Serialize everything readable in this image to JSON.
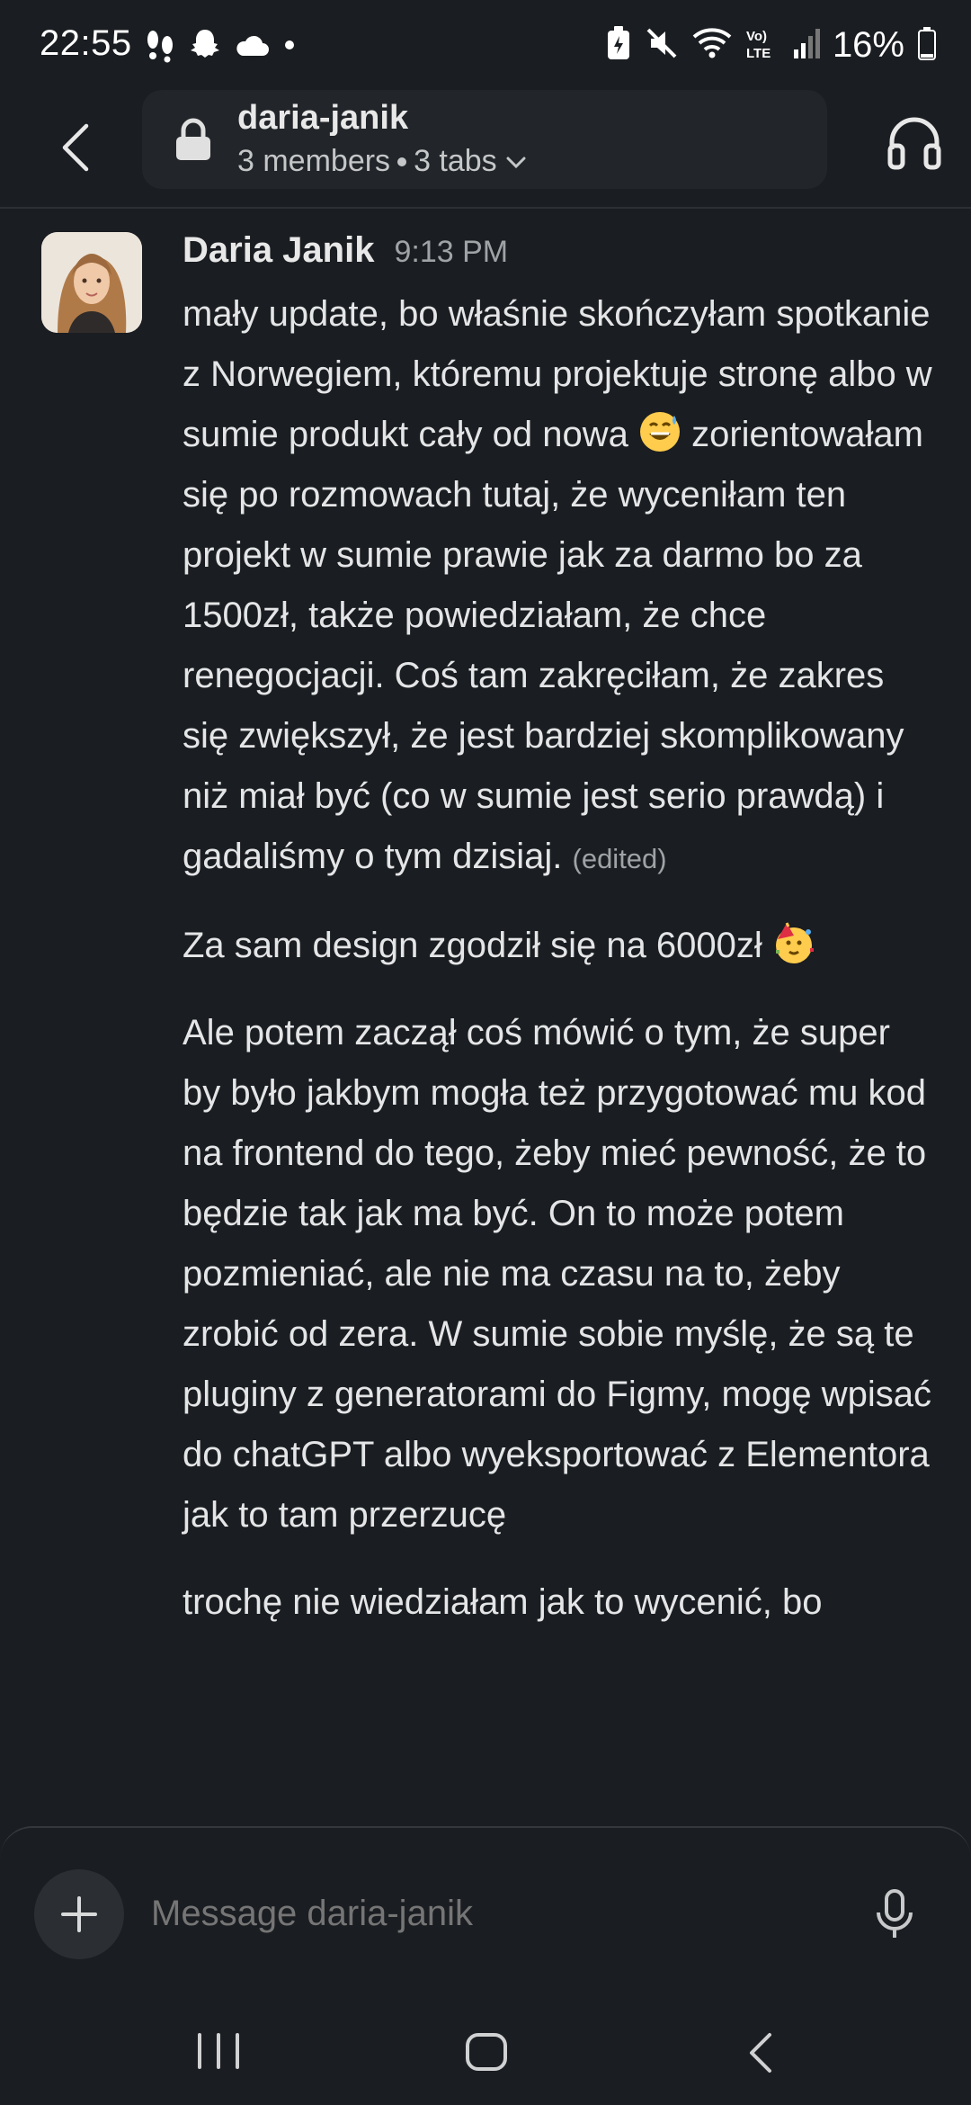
{
  "status_bar": {
    "time": "22:55",
    "battery": "16%"
  },
  "header": {
    "channel_name": "daria-janik",
    "members": "3 members",
    "tabs": "3 tabs"
  },
  "message": {
    "author": "Daria Janik",
    "time": "9:13 PM",
    "paragraphs": [
      "mały update, bo właśnie skończyłam spotkanie z Norwegiem, któremu projektuje stronę albo w sumie produkt cały od nowa",
      "zorientowałam się po rozmowach tutaj, że wyceniłam ten projekt w sumie prawie jak za darmo bo za 1500zł, także powiedziałam, że chce renegocjacji. Coś tam zakręciłam, że zakres się zwiększył, że jest bardziej skomplikowany niż miał być (co w sumie jest serio prawdą) i gadaliśmy o tym dzisiaj.",
      "Za sam design zgodził się na 6000zł",
      "Ale potem zaczął coś mówić o tym, że super by było jakbym mogła też przygotować mu kod na frontend do tego, żeby mieć pewność, że to będzie tak jak ma być. On to może potem pozmieniać, ale nie ma czasu na to, żeby zrobić od zera. W sumie sobie myślę, że są te pluginy z generatorami do Figmy, mogę wpisać do chatGPT albo wyeksportować z Elementora jak to tam przerzucę",
      "trochę nie wiedziałam jak to wycenić, bo"
    ],
    "edited_label": "(edited)",
    "emoji_1": "sweat-smile-emoji",
    "emoji_2": "partying-face-emoji"
  },
  "composer": {
    "placeholder": "Message daria-janik"
  },
  "colors": {
    "background": "#1a1d21",
    "header_pill": "#222529",
    "text": "#e4e5e6",
    "muted": "#a0a3a6"
  }
}
